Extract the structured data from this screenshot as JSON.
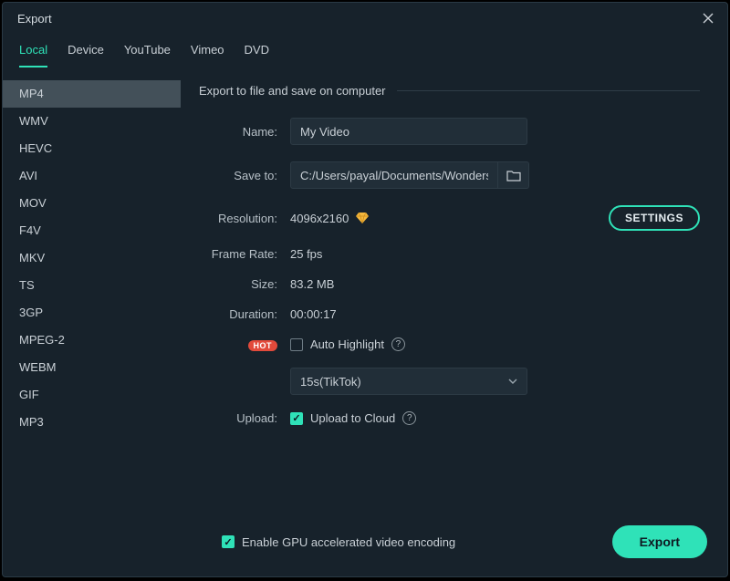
{
  "window": {
    "title": "Export"
  },
  "tabs": [
    {
      "label": "Local",
      "active": true
    },
    {
      "label": "Device",
      "active": false
    },
    {
      "label": "YouTube",
      "active": false
    },
    {
      "label": "Vimeo",
      "active": false
    },
    {
      "label": "DVD",
      "active": false
    }
  ],
  "formats": [
    {
      "label": "MP4",
      "selected": true
    },
    {
      "label": "WMV"
    },
    {
      "label": "HEVC"
    },
    {
      "label": "AVI"
    },
    {
      "label": "MOV"
    },
    {
      "label": "F4V"
    },
    {
      "label": "MKV"
    },
    {
      "label": "TS"
    },
    {
      "label": "3GP"
    },
    {
      "label": "MPEG-2"
    },
    {
      "label": "WEBM"
    },
    {
      "label": "GIF"
    },
    {
      "label": "MP3"
    }
  ],
  "section": {
    "title": "Export to file and save on computer"
  },
  "labels": {
    "name": "Name:",
    "save_to": "Save to:",
    "resolution": "Resolution:",
    "frame_rate": "Frame Rate:",
    "size": "Size:",
    "duration": "Duration:",
    "upload": "Upload:"
  },
  "fields": {
    "name_value": "My Video",
    "save_to_value": "C:/Users/payal/Documents/Wondershare/",
    "resolution_value": "4096x2160",
    "frame_rate_value": "25 fps",
    "size_value": "83.2 MB",
    "duration_value": "00:00:17",
    "settings_label": "SETTINGS",
    "hot_label": "HOT",
    "auto_highlight_label": "Auto Highlight",
    "auto_highlight_checked": false,
    "select_value": "15s(TikTok)",
    "upload_label": "Upload to Cloud",
    "upload_checked": true
  },
  "footer": {
    "gpu_label": "Enable GPU accelerated video encoding",
    "gpu_checked": true,
    "export_label": "Export"
  },
  "colors": {
    "accent": "#2fe2b8",
    "bg": "#17222b",
    "input_bg": "#212e38",
    "hot": "#e24a3b"
  }
}
